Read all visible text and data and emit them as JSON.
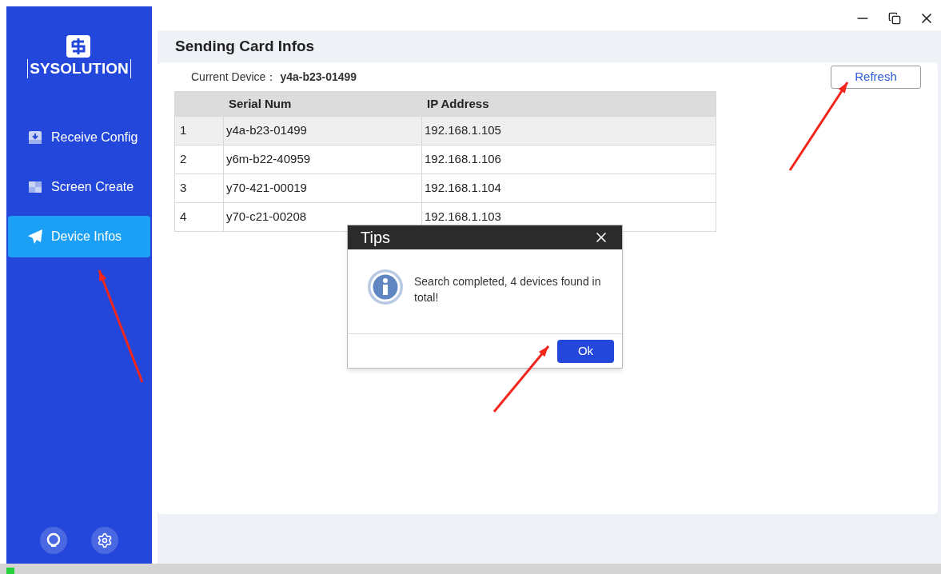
{
  "sidebar": {
    "brand": "SYSOLUTION",
    "items": [
      {
        "label": "Receive Config",
        "kind": "receive",
        "selected": false
      },
      {
        "label": "Screen Create",
        "kind": "screen",
        "selected": false
      },
      {
        "label": "Device Infos",
        "kind": "send",
        "selected": true
      }
    ]
  },
  "page": {
    "title": "Sending Card Infos",
    "current_device_label": "Current Device：",
    "current_device": "y4a-b23-01499",
    "refresh_button": "Refresh"
  },
  "table": {
    "columns": [
      "Serial Num",
      "IP Address"
    ],
    "rows": [
      {
        "index": "1",
        "serial": "y4a-b23-01499",
        "ip": "192.168.1.105",
        "selected": true
      },
      {
        "index": "2",
        "serial": "y6m-b22-40959",
        "ip": "192.168.1.106",
        "selected": false
      },
      {
        "index": "3",
        "serial": "y70-421-00019",
        "ip": "192.168.1.104",
        "selected": false
      },
      {
        "index": "4",
        "serial": "y70-c21-00208",
        "ip": "192.168.1.103",
        "selected": false
      }
    ]
  },
  "dialog": {
    "title": "Tips",
    "message": "Search completed, 4 devices found in total!",
    "ok_button": "Ok"
  }
}
